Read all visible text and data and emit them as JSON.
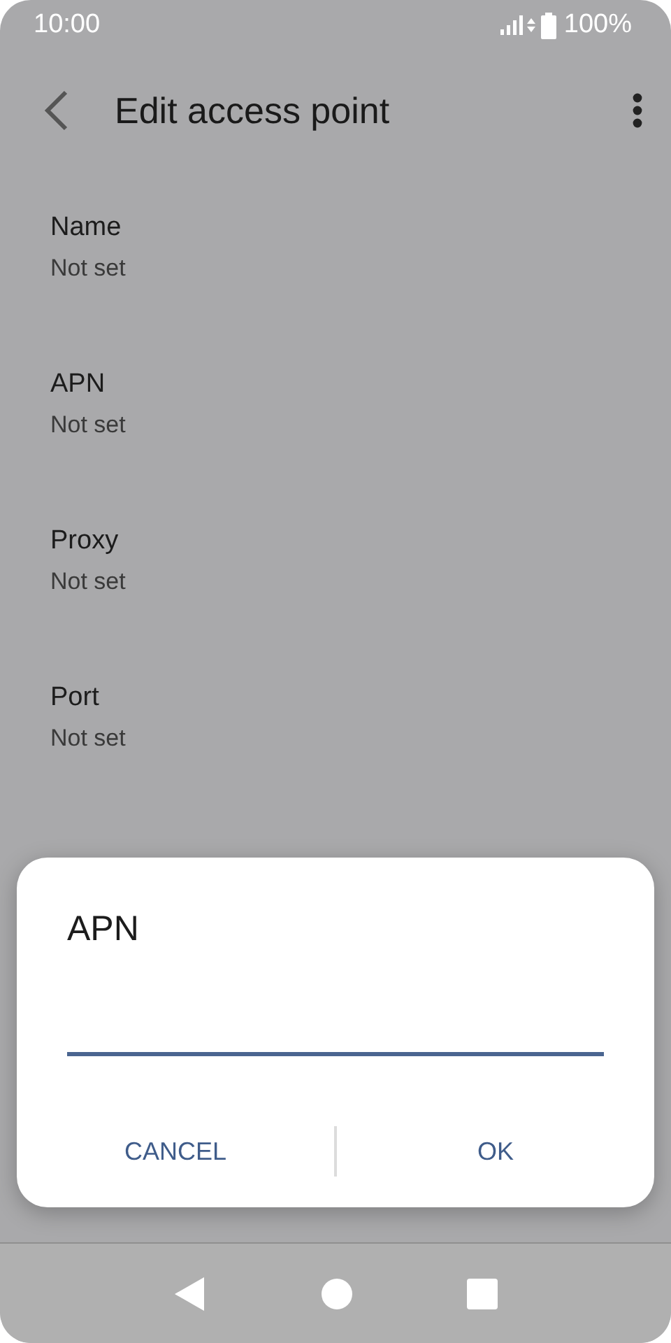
{
  "status_bar": {
    "time": "10:00",
    "battery": "100%"
  },
  "app_bar": {
    "title": "Edit access point"
  },
  "fields": [
    {
      "label": "Name",
      "value": "Not set"
    },
    {
      "label": "APN",
      "value": "Not set"
    },
    {
      "label": "Proxy",
      "value": "Not set"
    },
    {
      "label": "Port",
      "value": "Not set"
    }
  ],
  "dialog": {
    "title": "APN",
    "buttons": [
      "CANCEL",
      "OK"
    ]
  }
}
